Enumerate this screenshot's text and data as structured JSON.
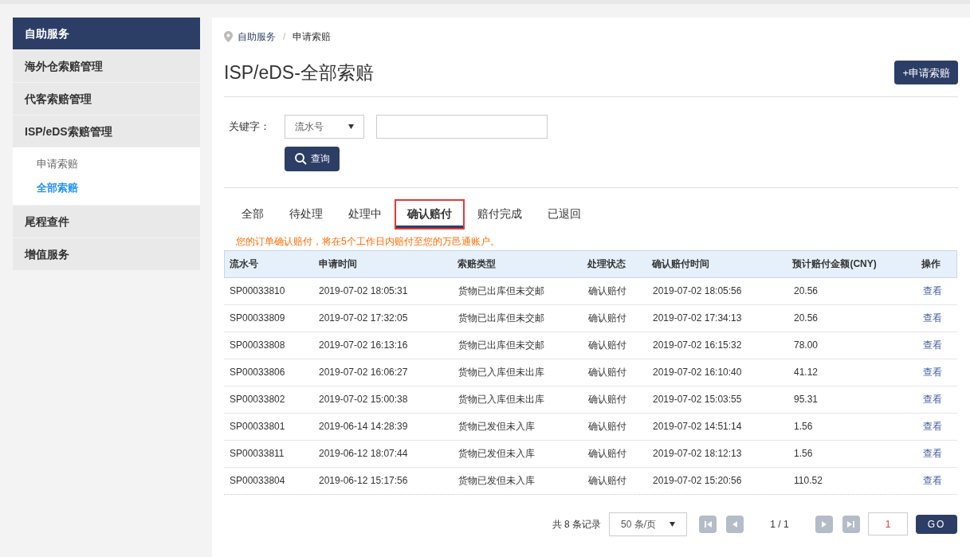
{
  "sidebar": {
    "items": [
      {
        "label": "自助服务",
        "selected": true
      },
      {
        "label": "海外仓索赔管理",
        "selected": false
      },
      {
        "label": "代客索赔管理",
        "selected": false
      },
      {
        "label": "ISP/eDS索赔管理",
        "selected": false,
        "children": [
          {
            "label": "申请索赔",
            "selected": false
          },
          {
            "label": "全部索赔",
            "selected": true
          }
        ]
      },
      {
        "label": "尾程查件",
        "selected": false
      },
      {
        "label": "增值服务",
        "selected": false
      }
    ]
  },
  "breadcrumb": {
    "items": [
      "自助服务",
      "申请索赔"
    ],
    "separator": "/"
  },
  "title": "ISP/eDS-全部索赔",
  "new_button": "+申请索赔",
  "search": {
    "label": "关键字：",
    "select_value": "流水号",
    "button": "查询"
  },
  "tabs": [
    {
      "label": "全部",
      "selected": false
    },
    {
      "label": "待处理",
      "selected": false
    },
    {
      "label": "处理中",
      "selected": false
    },
    {
      "label": "确认赔付",
      "selected": true
    },
    {
      "label": "赔付完成",
      "selected": false
    },
    {
      "label": "已退回",
      "selected": false
    }
  ],
  "notice": "您的订单确认赔付，将在5个工作日内赔付至您的万邑通账户。",
  "table": {
    "columns": [
      "流水号",
      "申请时间",
      "索赔类型",
      "处理状态",
      "确认赔付时间",
      "预计赔付金额(CNY)",
      "操作"
    ],
    "rows": [
      [
        "SP00033810",
        "2019-07-02 18:05:31",
        "货物已出库但未交邮",
        "确认赔付",
        "2019-07-02 18:05:56",
        "20.56",
        "查看"
      ],
      [
        "SP00033809",
        "2019-07-02 17:32:05",
        "货物已出库但未交邮",
        "确认赔付",
        "2019-07-02 17:34:13",
        "20.56",
        "查看"
      ],
      [
        "SP00033808",
        "2019-07-02 16:13:16",
        "货物已出库但未交邮",
        "确认赔付",
        "2019-07-02 16:15:32",
        "78.00",
        "查看"
      ],
      [
        "SP00033806",
        "2019-07-02 16:06:27",
        "货物已入库但未出库",
        "确认赔付",
        "2019-07-02 16:10:40",
        "41.12",
        "查看"
      ],
      [
        "SP00033802",
        "2019-07-02 15:00:38",
        "货物已入库但未出库",
        "确认赔付",
        "2019-07-02 15:03:55",
        "95.31",
        "查看"
      ],
      [
        "SP00033801",
        "2019-06-14 14:28:39",
        "货物已发但未入库",
        "确认赔付",
        "2019-07-02 14:51:14",
        "1.56",
        "查看"
      ],
      [
        "SP00033811",
        "2019-06-12 18:07:44",
        "货物已发但未入库",
        "确认赔付",
        "2019-07-02 18:12:13",
        "1.56",
        "查看"
      ],
      [
        "SP00033804",
        "2019-06-12 15:17:56",
        "货物已发但未入库",
        "确认赔付",
        "2019-07-02 15:20:56",
        "110.52",
        "查看"
      ]
    ]
  },
  "pagination": {
    "total": "共 8 条记录",
    "page_size": "50 条/页",
    "page": "1 / 1",
    "page_input": "1",
    "go": "GO"
  }
}
